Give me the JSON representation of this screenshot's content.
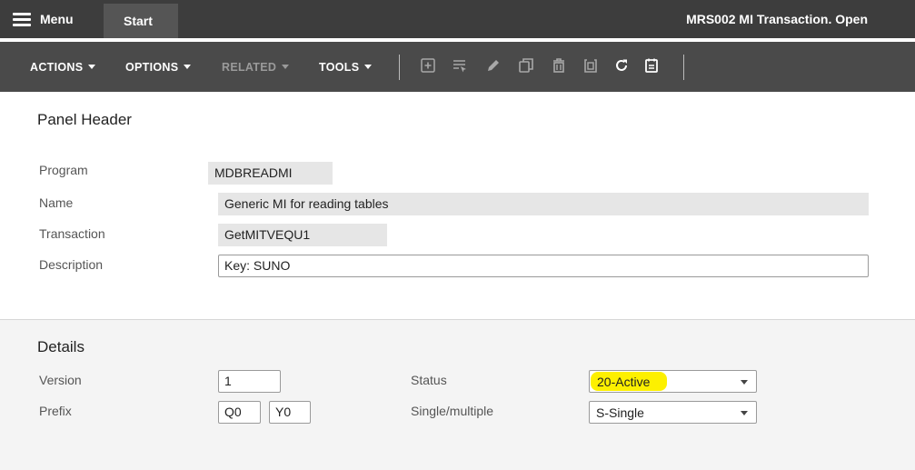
{
  "topbar": {
    "menu_label": "Menu",
    "start_tab": "Start",
    "window_title": "MRS002 MI Transaction. Open"
  },
  "toolbar": {
    "actions": "ACTIONS",
    "options": "OPTIONS",
    "related": "RELATED",
    "tools": "TOOLS",
    "icons": [
      "add-icon",
      "select-list-icon",
      "edit-icon",
      "copy-icon",
      "delete-icon",
      "paste-icon",
      "refresh-icon",
      "notes-icon"
    ]
  },
  "panel_header": {
    "title": "Panel Header",
    "program_label": "Program",
    "program_value": "MDBREADMI",
    "name_label": "Name",
    "name_value": "Generic MI for reading tables",
    "transaction_label": "Transaction",
    "transaction_value": "GetMITVEQU1",
    "description_label": "Description",
    "description_value": "Key: SUNO"
  },
  "details": {
    "title": "Details",
    "version_label": "Version",
    "version_value": "1",
    "prefix_label": "Prefix",
    "prefix_value_1": "Q0",
    "prefix_value_2": "Y0",
    "status_label": "Status",
    "status_value": "20-Active",
    "single_multiple_label": "Single/multiple",
    "single_multiple_value": "S-Single"
  },
  "colors": {
    "topbar_bg": "#3d3d3d",
    "toolbar_bg": "#4a4a4a",
    "highlight": "#fdf000"
  }
}
